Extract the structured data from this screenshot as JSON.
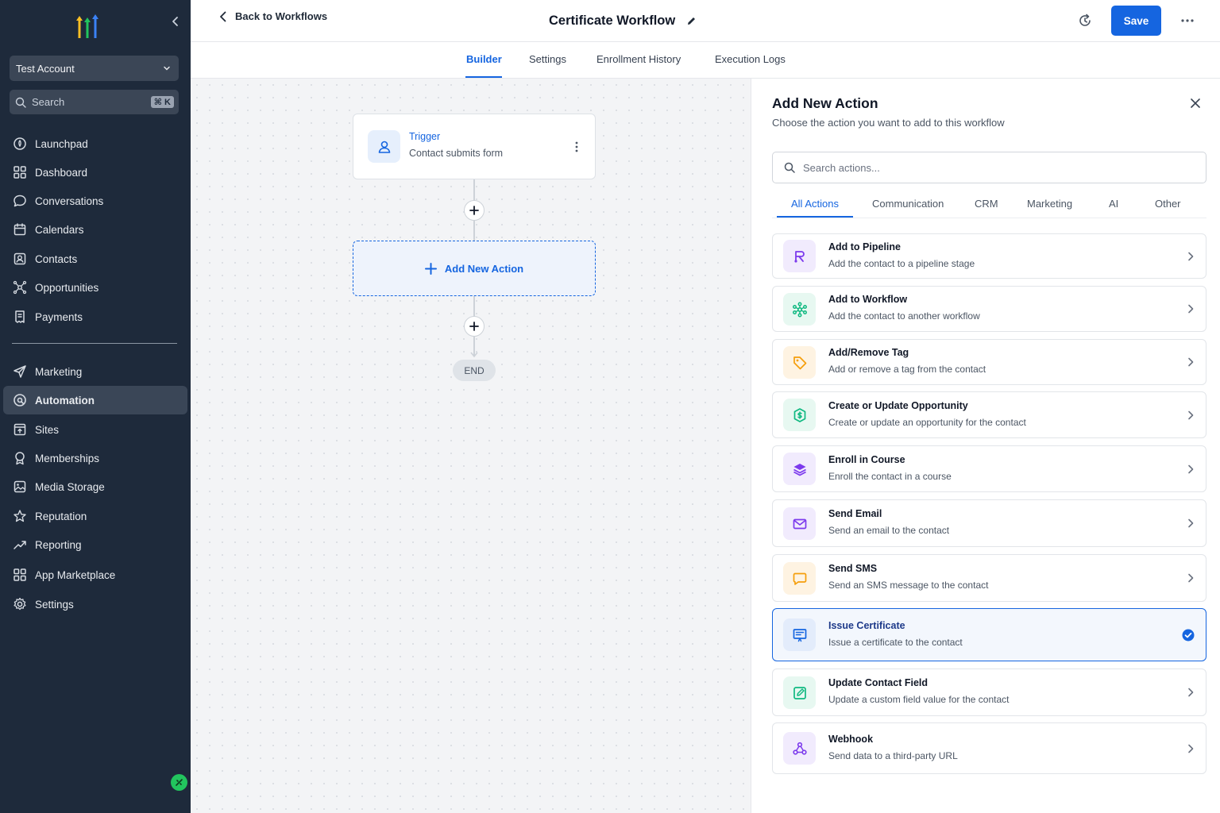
{
  "sidebar": {
    "account": "Test Account",
    "search": {
      "label": "Search",
      "shortcut": "⌘ K"
    },
    "items": [
      {
        "label": "Launchpad",
        "icon": "rocket-icon"
      },
      {
        "label": "Dashboard",
        "icon": "grid-icon"
      },
      {
        "label": "Conversations",
        "icon": "chat-icon"
      },
      {
        "label": "Calendars",
        "icon": "calendar-icon"
      },
      {
        "label": "Contacts",
        "icon": "contact-card-icon"
      },
      {
        "label": "Opportunities",
        "icon": "network-icon"
      },
      {
        "label": "Payments",
        "icon": "receipt-icon"
      },
      {
        "label": "Marketing",
        "icon": "send-icon"
      },
      {
        "label": "Automation",
        "icon": "automation-icon",
        "active": true
      },
      {
        "label": "Sites",
        "icon": "sites-icon"
      },
      {
        "label": "Memberships",
        "icon": "badge-icon"
      },
      {
        "label": "Media Storage",
        "icon": "image-icon"
      },
      {
        "label": "Reputation",
        "icon": "star-icon"
      },
      {
        "label": "Reporting",
        "icon": "trend-icon"
      },
      {
        "label": "App Marketplace",
        "icon": "apps-grid-icon"
      },
      {
        "label": "Settings",
        "icon": "gear-icon"
      }
    ]
  },
  "header": {
    "back_label": "Back to Workflows",
    "workflow_title": "Certificate Workflow",
    "save_label": "Save"
  },
  "tabs": [
    {
      "label": "Builder",
      "active": true
    },
    {
      "label": "Settings"
    },
    {
      "label": "Enrollment History"
    },
    {
      "label": "Execution Logs"
    }
  ],
  "canvas": {
    "trigger": {
      "title": "Trigger",
      "subtitle": "Contact submits form"
    },
    "add_action_label": "Add New Action",
    "end_label": "END"
  },
  "panel": {
    "title": "Add New Action",
    "subtitle": "Choose the action you want to add to this workflow",
    "search_placeholder": "Search actions...",
    "categories": [
      {
        "label": "All Actions",
        "active": true
      },
      {
        "label": "Communication"
      },
      {
        "label": "CRM"
      },
      {
        "label": "Marketing"
      },
      {
        "label": "AI"
      },
      {
        "label": "Other"
      }
    ],
    "actions": [
      {
        "title": "Add to Pipeline",
        "description": "Add the contact to a pipeline stage",
        "icon": "pipeline-icon",
        "color": "#7c3aed",
        "bg": "#f1ebfd"
      },
      {
        "title": "Add to Workflow",
        "description": "Add the contact to another workflow",
        "icon": "workflow-icon",
        "color": "#10b981",
        "bg": "#e7f8f1"
      },
      {
        "title": "Add/Remove Tag",
        "description": "Add or remove a tag from the contact",
        "icon": "tag-icon",
        "color": "#f59e0b",
        "bg": "#fef3e2"
      },
      {
        "title": "Create or Update Opportunity",
        "description": "Create or update an opportunity for the contact",
        "icon": "opportunity-icon",
        "color": "#10b981",
        "bg": "#e7f8f1"
      },
      {
        "title": "Enroll in Course",
        "description": "Enroll the contact in a course",
        "icon": "layers-icon",
        "color": "#7c3aed",
        "bg": "#f1ebfd"
      },
      {
        "title": "Send Email",
        "description": "Send an email to the contact",
        "icon": "mail-icon",
        "color": "#7c3aed",
        "bg": "#f1ebfd"
      },
      {
        "title": "Send SMS",
        "description": "Send an SMS message to the contact",
        "icon": "sms-icon",
        "color": "#f59e0b",
        "bg": "#fef3e2"
      },
      {
        "title": "Issue Certificate",
        "description": "Issue a certificate to the contact",
        "icon": "certificate-icon",
        "color": "#1565e0",
        "bg": "#e3ecfb",
        "selected": true
      },
      {
        "title": "Update Contact Field",
        "description": "Update a custom field value for the contact",
        "icon": "edit-field-icon",
        "color": "#10b981",
        "bg": "#e7f8f1"
      },
      {
        "title": "Webhook",
        "description": "Send data to a third-party URL",
        "icon": "webhook-icon",
        "color": "#7c3aed",
        "bg": "#f1ebfd"
      }
    ]
  },
  "colors": {
    "accent": "#1565e0",
    "sidebar_bg": "#1e2a3b"
  }
}
